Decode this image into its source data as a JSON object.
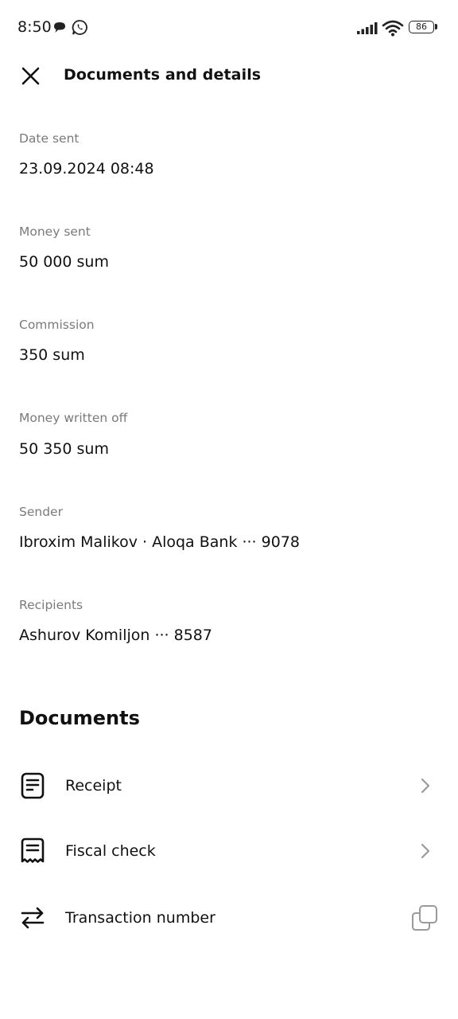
{
  "status_bar": {
    "time": "8:50",
    "battery": "86"
  },
  "header": {
    "title": "Documents and details"
  },
  "fields": [
    {
      "label": "Date sent",
      "value": "23.09.2024 08:48"
    },
    {
      "label": "Money sent",
      "value": "50 000 sum"
    },
    {
      "label": "Commission",
      "value": "350 sum"
    },
    {
      "label": "Money written off",
      "value": "50 350 sum"
    },
    {
      "label": "Sender",
      "value": "Ibroxim Malikov · Aloqa Bank ··· 9078"
    },
    {
      "label": "Recipients",
      "value": "Ashurov Komiljon ··· 8587"
    }
  ],
  "documents": {
    "title": "Documents",
    "items": [
      {
        "label": "Receipt",
        "icon": "receipt-icon"
      },
      {
        "label": "Fiscal check",
        "icon": "fiscal-check-icon"
      },
      {
        "label": "Transaction number",
        "icon": "transfer-arrows-icon"
      }
    ]
  }
}
